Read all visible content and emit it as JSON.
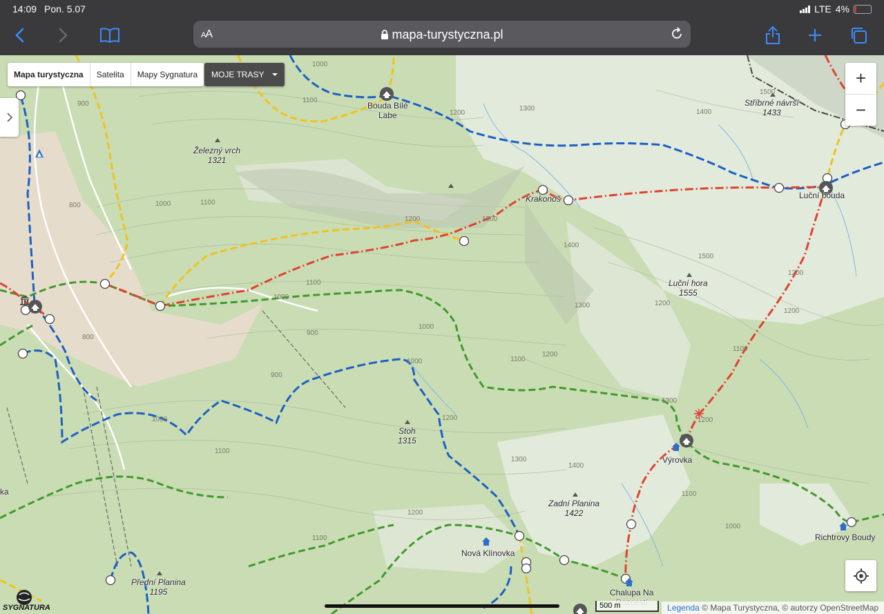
{
  "status_bar": {
    "time": "14:09",
    "date": "Pon. 5.07",
    "network": "LTE",
    "battery": "4%"
  },
  "browser": {
    "text_size_label": "AA",
    "url": "mapa-turystyczna.pl",
    "icons": [
      "back-icon",
      "forward-icon",
      "bookmarks-icon",
      "share-icon",
      "new-tab-icon",
      "tabs-icon",
      "lock-icon",
      "reload-icon"
    ]
  },
  "map_controls": {
    "layers": [
      "Mapa turystyczna",
      "Satelita",
      "Mapy Sygnatura"
    ],
    "active_layer": "Mapa turystyczna",
    "my_routes": "MOJE TRASY",
    "zoom_in": "+",
    "zoom_out": "−",
    "scale": "500 m",
    "legend_link": "Legenda",
    "attribution": "© Mapa Turystyczna, © autorzy OpenStreetMap",
    "logo_text": "SYGNATURA"
  },
  "places": {
    "bouda_bile_labe": "Bouda Bílé\nLabe",
    "zelezny_vrch": "Železný vrch",
    "zelezny_vrch_elev": "1321",
    "krakonos": "Krakonoš",
    "stribrne_navrsi": "Stříbrné návrší",
    "stribrne_navrsi_elev": "1433",
    "lucni_bouda": "Luční bouda",
    "lucni_hora": "Luční hora",
    "lucni_hora_elev": "1555",
    "stoh": "Stoh",
    "stoh_elev": "1315",
    "vyrovka": "Výrovka",
    "zadni_planina": "Zadní Planina",
    "zadni_planina_elev": "1422",
    "richtrovy_boudy": "Richtrovy Boudy",
    "nova_klinovka": "Nová Klínovka",
    "predni_planina": "Přední Planina",
    "predni_planina_elev": "1195",
    "chalupa_na": "Chalupa Na",
    "rozcesti": "Rozcestí",
    "edge_ka": "ka"
  },
  "contour_labels": [
    "1000",
    "1100",
    "1200",
    "1300",
    "1400",
    "1500",
    "900",
    "800",
    "1000",
    "1100",
    "1200",
    "1300",
    "1400",
    "1500",
    "1200",
    "1100",
    "1000",
    "900",
    "1000",
    "1100",
    "1200",
    "1300",
    "1200",
    "1200",
    "1100",
    "1000",
    "900",
    "800",
    "1000",
    "1100",
    "1200",
    "1300",
    "1400",
    "1300",
    "1200",
    "1100",
    "1000",
    "1200",
    "1100"
  ],
  "colors": {
    "trail_red": "#e0412f",
    "trail_blue": "#1a5fc4",
    "trail_green": "#3f9a2a",
    "trail_yellow": "#f2c21a",
    "terrain": "#c9dcb4",
    "meadow": "#e6eddd"
  }
}
